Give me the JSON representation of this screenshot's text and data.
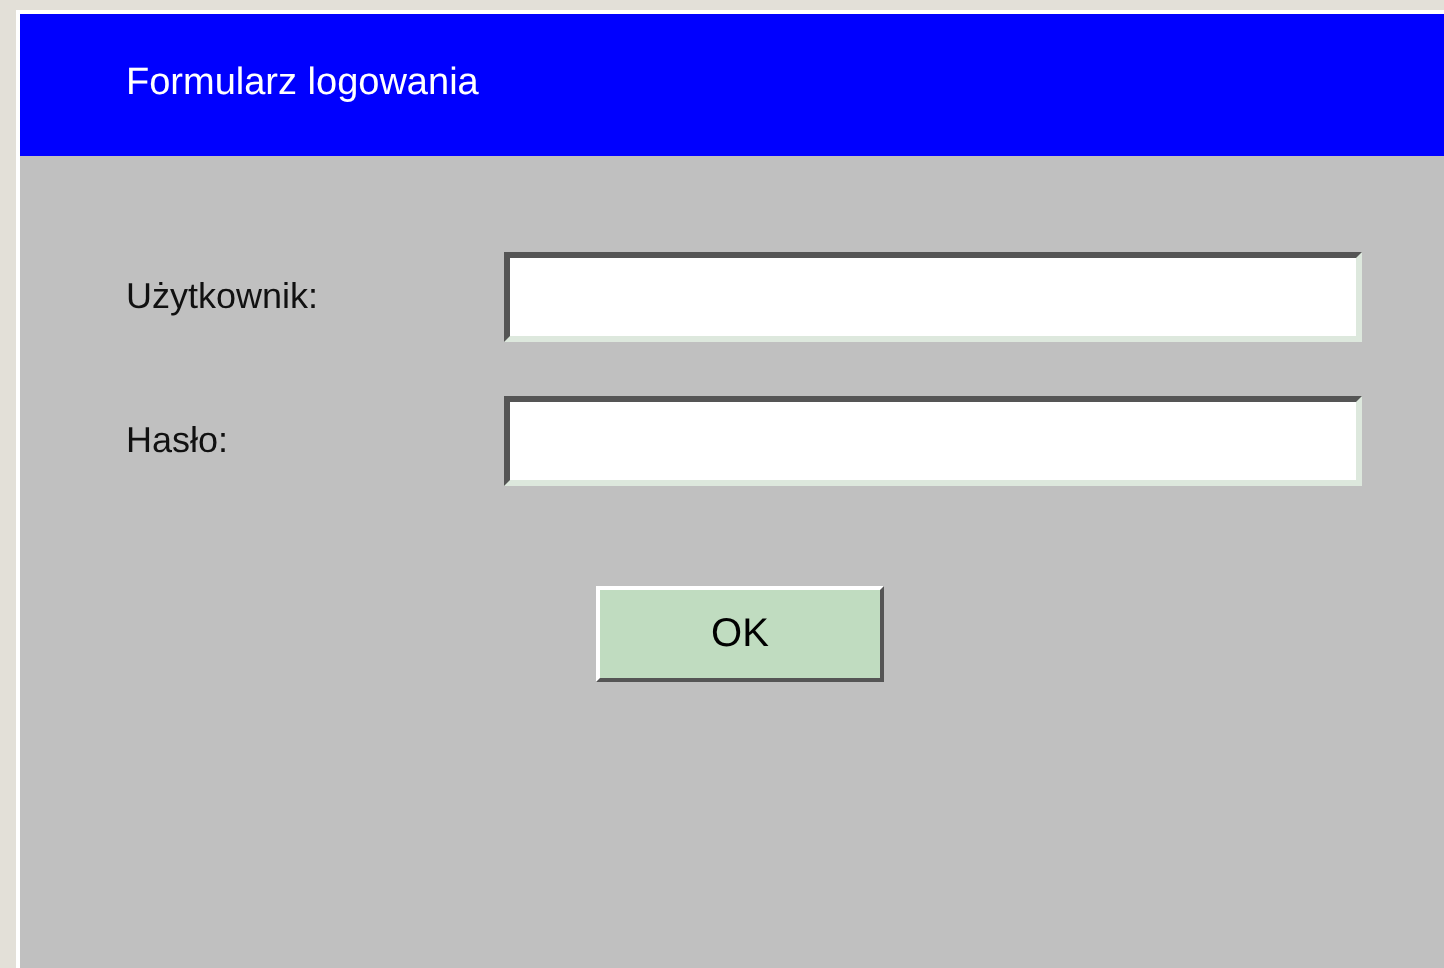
{
  "window": {
    "title": "Formularz logowania"
  },
  "fields": [
    {
      "label": "Użytkownik:"
    },
    {
      "label": "Hasło:"
    }
  ],
  "buttons": [
    "OK"
  ]
}
